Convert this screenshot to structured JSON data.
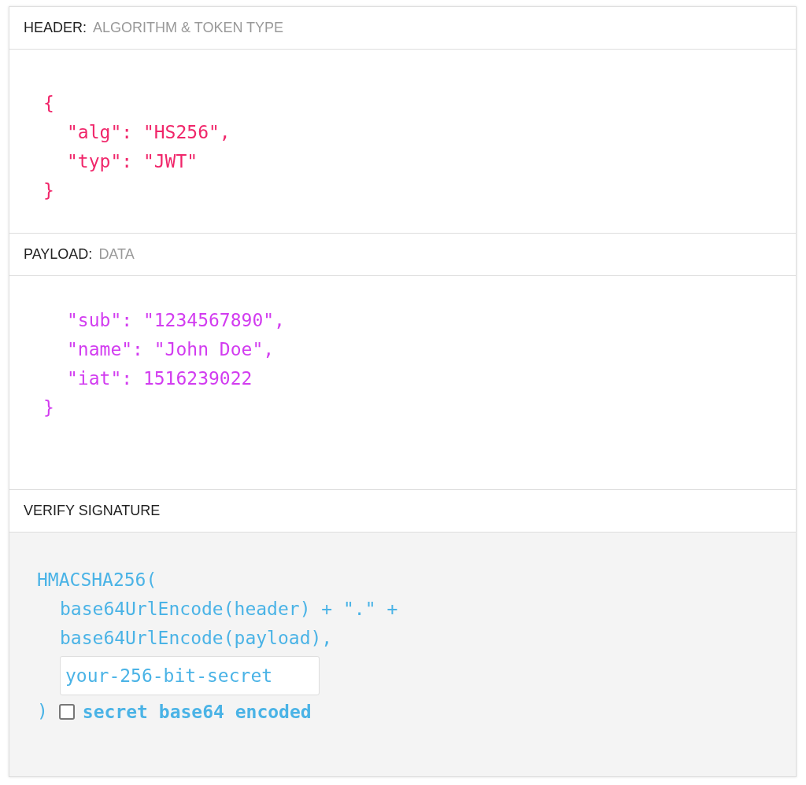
{
  "sections": [
    {
      "kind": "header",
      "title": "HEADER:",
      "subtitle": "ALGORITHM & TOKEN TYPE",
      "lines": [
        {
          "kind": "brace",
          "text": "{"
        },
        {
          "kind": "entry",
          "text": "\"alg\": \"HS256\","
        },
        {
          "kind": "entry",
          "text": "\"typ\": \"JWT\""
        },
        {
          "kind": "brace",
          "text": "}"
        }
      ]
    },
    {
      "kind": "payload",
      "title": "PAYLOAD:",
      "subtitle": "DATA",
      "lines": [
        {
          "kind": "entry",
          "text": "\"sub\": \"1234567890\","
        },
        {
          "kind": "entry",
          "text": "\"name\": \"John Doe\","
        },
        {
          "kind": "entry",
          "text": "\"iat\": 1516239022"
        },
        {
          "kind": "brace",
          "text": "}"
        }
      ]
    },
    {
      "kind": "verify",
      "title": "VERIFY SIGNATURE",
      "function": "HMACSHA256(",
      "args": [
        "base64UrlEncode(header) + \".\" +",
        "base64UrlEncode(payload),"
      ],
      "secret_field": {
        "value": "your-256-bit-secret"
      },
      "close": ")",
      "checkbox": {
        "label": "secret base64 encoded",
        "checked": false
      }
    }
  ]
}
